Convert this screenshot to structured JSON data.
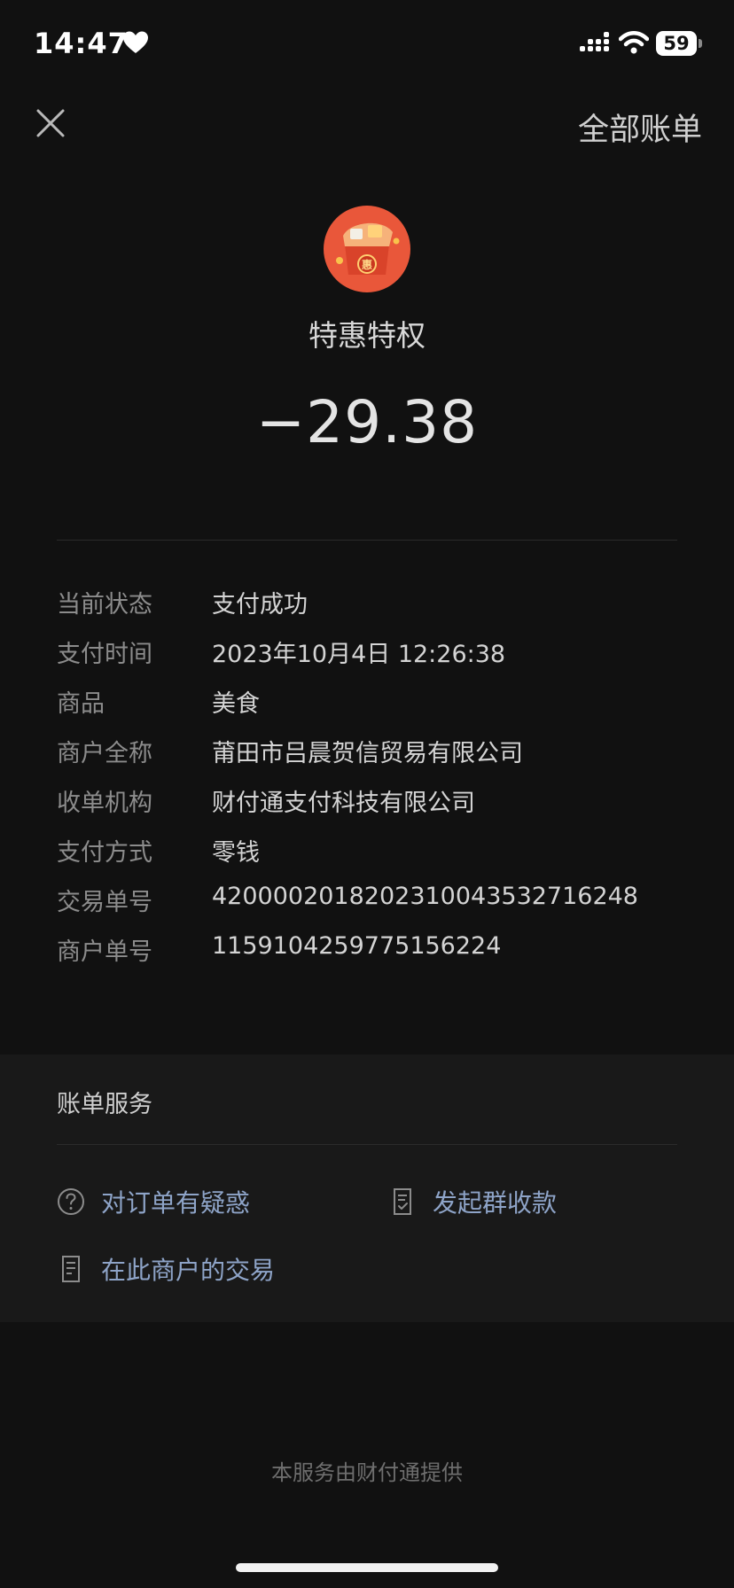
{
  "status_bar": {
    "time": "14:47",
    "battery": "59"
  },
  "header": {
    "all_bills": "全部账单"
  },
  "merchant": {
    "name": "特惠特权",
    "amount": "−29.38",
    "logo_badge": "惠"
  },
  "details": [
    {
      "label": "当前状态",
      "value": "支付成功"
    },
    {
      "label": "支付时间",
      "value": "2023年10月4日 12:26:38"
    },
    {
      "label": "商品",
      "value": "美食"
    },
    {
      "label": "商户全称",
      "value": "莆田市吕晨贺信贸易有限公司"
    },
    {
      "label": "收单机构",
      "value": "财付通支付科技有限公司"
    },
    {
      "label": "支付方式",
      "value": "零钱"
    },
    {
      "label": "交易单号",
      "value": "4200002018202310043532716248"
    },
    {
      "label": "商户单号",
      "value": "1159104259775156224"
    }
  ],
  "services": {
    "title": "账单服务",
    "items": [
      {
        "label": "对订单有疑惑",
        "icon": "question-circle-icon"
      },
      {
        "label": "发起群收款",
        "icon": "receipt-check-icon"
      },
      {
        "label": "在此商户的交易",
        "icon": "document-list-icon"
      }
    ]
  },
  "footer": "本服务由财付通提供",
  "colors": {
    "background": "#111111",
    "card": "#191919",
    "link_blue": "#8ea4c8",
    "logo_orange": "#e9573a"
  }
}
